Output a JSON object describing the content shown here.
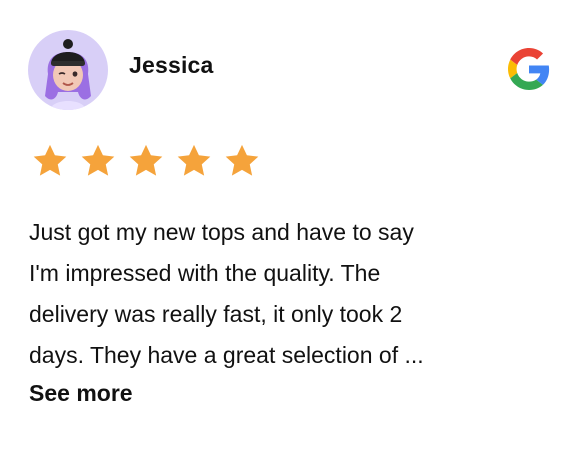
{
  "review": {
    "reviewer_name": "Jessica",
    "rating": 5,
    "rating_max": 5,
    "text_lines": [
      "Just got my new tops and have to say",
      "I'm impressed with the quality. The",
      "delivery was really fast, it only took 2",
      "days. They have a great selection of ..."
    ],
    "see_more_label": "See more",
    "source_icon": "google-g-icon"
  },
  "colors": {
    "star": "#F5A33B",
    "avatar_bg": "#D8CFF7",
    "google_blue": "#4285F4",
    "google_red": "#EA4335",
    "google_yellow": "#FBBC05",
    "google_green": "#34A853"
  }
}
